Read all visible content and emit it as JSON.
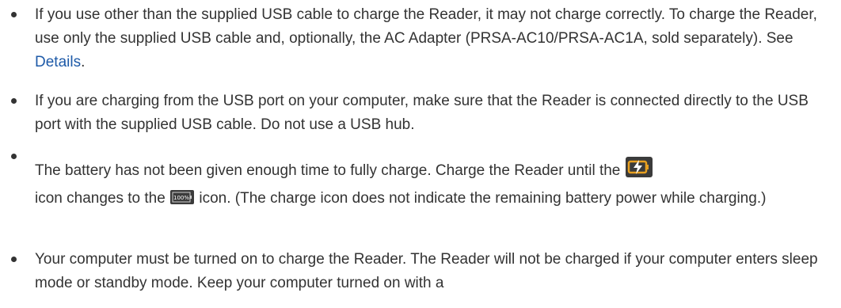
{
  "items": [
    {
      "text": "If you use other than the supplied USB cable to charge the Reader, it may not charge correctly. To charge the Reader, use only the supplied USB cable and, optionally, the AC Adapter (PRSA-AC10/PRSA-AC1A, sold separately). See ",
      "link": "Details",
      "text_end": "."
    },
    {
      "text": "If you are charging from the USB port on your computer, make sure that the Reader is connected directly to the USB port with the supplied USB cable. Do not use a USB hub."
    },
    {
      "text_a": "The battery has not been given enough time to fully charge. Charge the Reader until the ",
      "text_b": "icon changes to the ",
      "text_c": " icon. (The charge icon does not indicate the remaining battery power while charging.)",
      "icon_charging": "charging-battery-icon",
      "icon_full": "full-battery-icon"
    },
    {
      "text": "Your computer must be turned on to charge the Reader. The Reader will not be charged if your computer enters sleep mode or standby mode. Keep your computer turned on with a"
    }
  ],
  "colors": {
    "text": "#333333",
    "link": "#1e5aa8",
    "icon_bg": "#3b3b3b",
    "icon_charge_accent": "#e8a020"
  }
}
